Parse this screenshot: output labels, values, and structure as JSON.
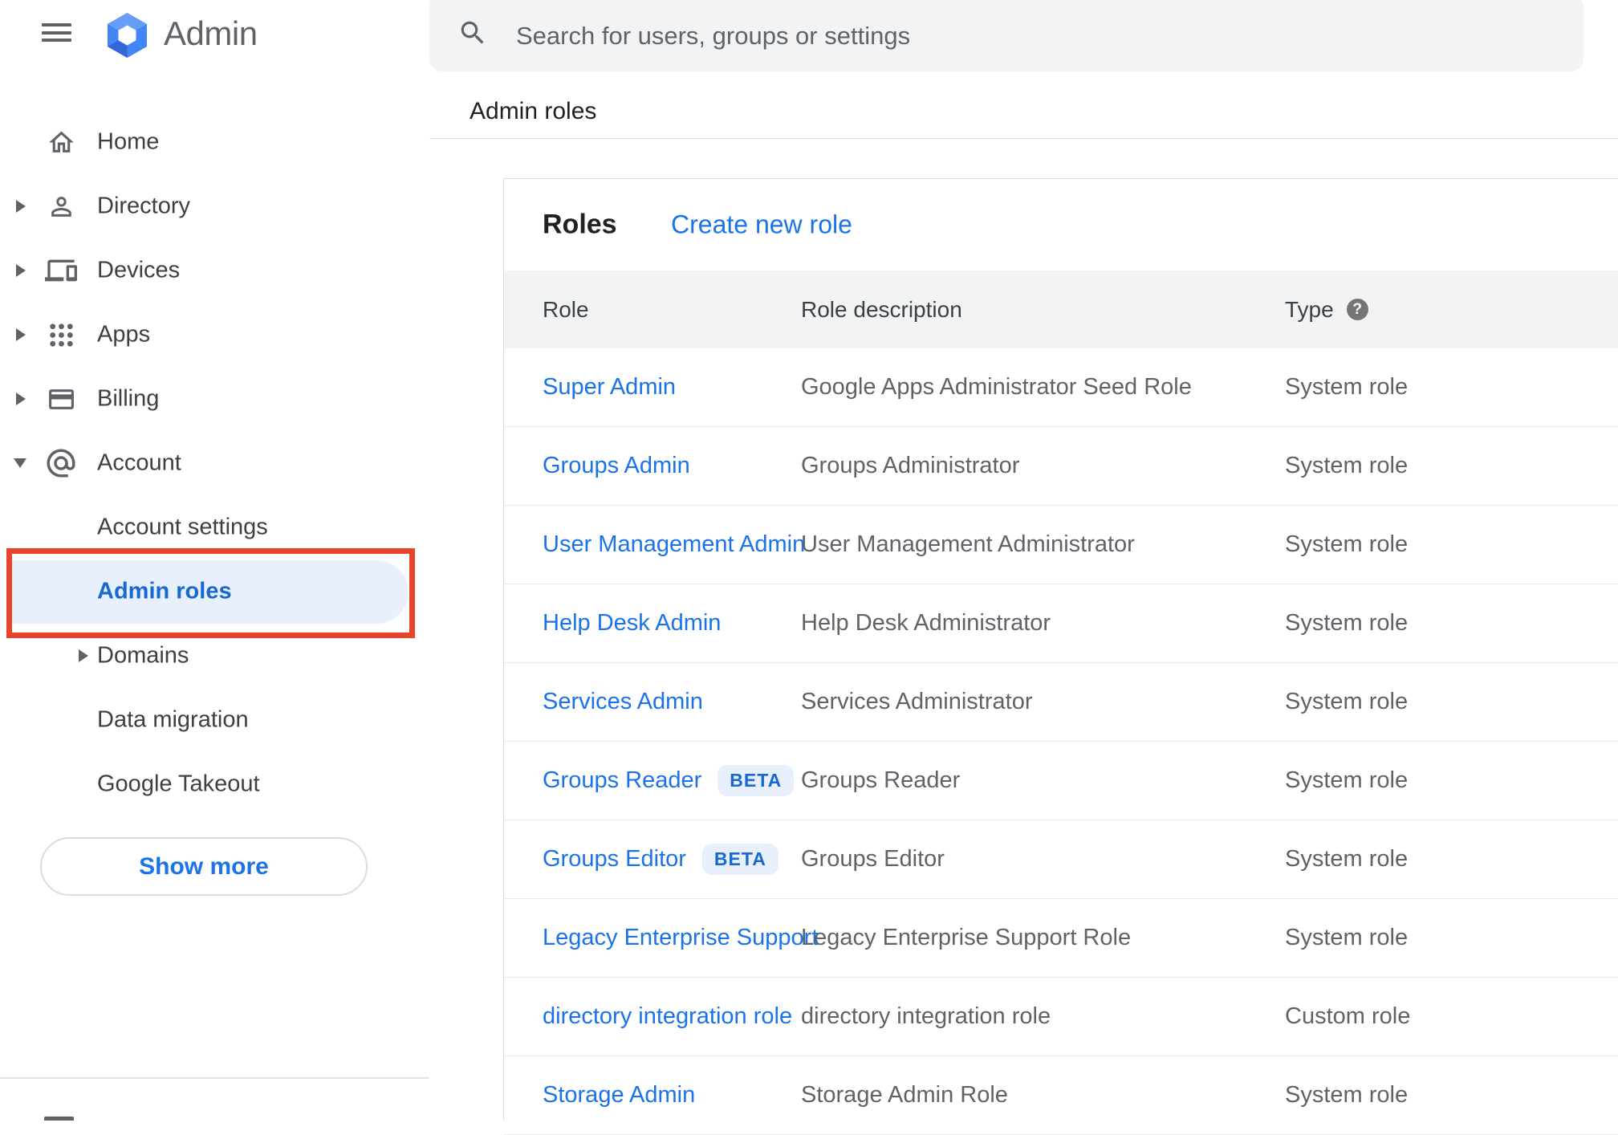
{
  "brand": {
    "title": "Admin",
    "menu_icon": "hamburger-icon",
    "logo_icon": "google-admin-hexagon-logo"
  },
  "topbar": {
    "search_placeholder": "Search for users, groups or settings",
    "search_icon": "search-icon"
  },
  "breadcrumb": "Admin roles",
  "sidebar": {
    "items": [
      {
        "label": "Home",
        "icon": "home-icon",
        "expand": "none"
      },
      {
        "label": "Directory",
        "icon": "person-icon",
        "expand": "collapsed"
      },
      {
        "label": "Devices",
        "icon": "devices-icon",
        "expand": "collapsed"
      },
      {
        "label": "Apps",
        "icon": "apps-grid-icon",
        "expand": "collapsed"
      },
      {
        "label": "Billing",
        "icon": "credit-card-icon",
        "expand": "collapsed"
      },
      {
        "label": "Account",
        "icon": "at-email-icon",
        "expand": "expanded"
      }
    ],
    "account_children": [
      {
        "label": "Account settings",
        "selected": false
      },
      {
        "label": "Admin roles",
        "selected": true,
        "annotated": true
      },
      {
        "label": "Domains",
        "expand": "collapsed"
      },
      {
        "label": "Data migration"
      },
      {
        "label": "Google Takeout"
      }
    ],
    "show_more_label": "Show more"
  },
  "panel": {
    "title": "Roles",
    "create_link": "Create new role",
    "table": {
      "headers": {
        "role": "Role",
        "description": "Role description",
        "type": "Type"
      },
      "type_help_icon": "question-mark-help-icon",
      "beta_label": "BETA",
      "rows": [
        {
          "role": "Super Admin",
          "beta": false,
          "description": "Google Apps Administrator Seed Role",
          "type": "System role"
        },
        {
          "role": "Groups Admin",
          "beta": false,
          "description": "Groups Administrator",
          "type": "System role"
        },
        {
          "role": "User Management Admin",
          "beta": false,
          "description": "User Management Administrator",
          "type": "System role"
        },
        {
          "role": "Help Desk Admin",
          "beta": false,
          "description": "Help Desk Administrator",
          "type": "System role"
        },
        {
          "role": "Services Admin",
          "beta": false,
          "description": "Services Administrator",
          "type": "System role"
        },
        {
          "role": "Groups Reader",
          "beta": true,
          "description": "Groups Reader",
          "type": "System role"
        },
        {
          "role": "Groups Editor",
          "beta": true,
          "description": "Groups Editor",
          "type": "System role"
        },
        {
          "role": "Legacy Enterprise Support",
          "beta": false,
          "description": "Legacy Enterprise Support Role",
          "type": "System role"
        },
        {
          "role": "directory integration role",
          "beta": false,
          "description": "directory integration role",
          "type": "Custom role"
        },
        {
          "role": "Storage Admin",
          "beta": false,
          "description": "Storage Admin Role",
          "type": "System role"
        }
      ]
    }
  },
  "annotation": {
    "type": "red-highlight-box",
    "target": "Admin roles sidebar item",
    "color": "#e8432b"
  },
  "colors": {
    "link_blue": "#1a73e8",
    "selected_blue": "#1967d2",
    "selected_bg": "#e8f0fe",
    "badge_bg": "#e8f0fe",
    "badge_text": "#1967d2",
    "header_row_bg": "#f1f3f4",
    "search_bg": "#f1f3f4",
    "text_gray": "#5f6368",
    "text_dark": "#202124",
    "divider": "#e8eaed",
    "annotation_red": "#e8432b"
  }
}
